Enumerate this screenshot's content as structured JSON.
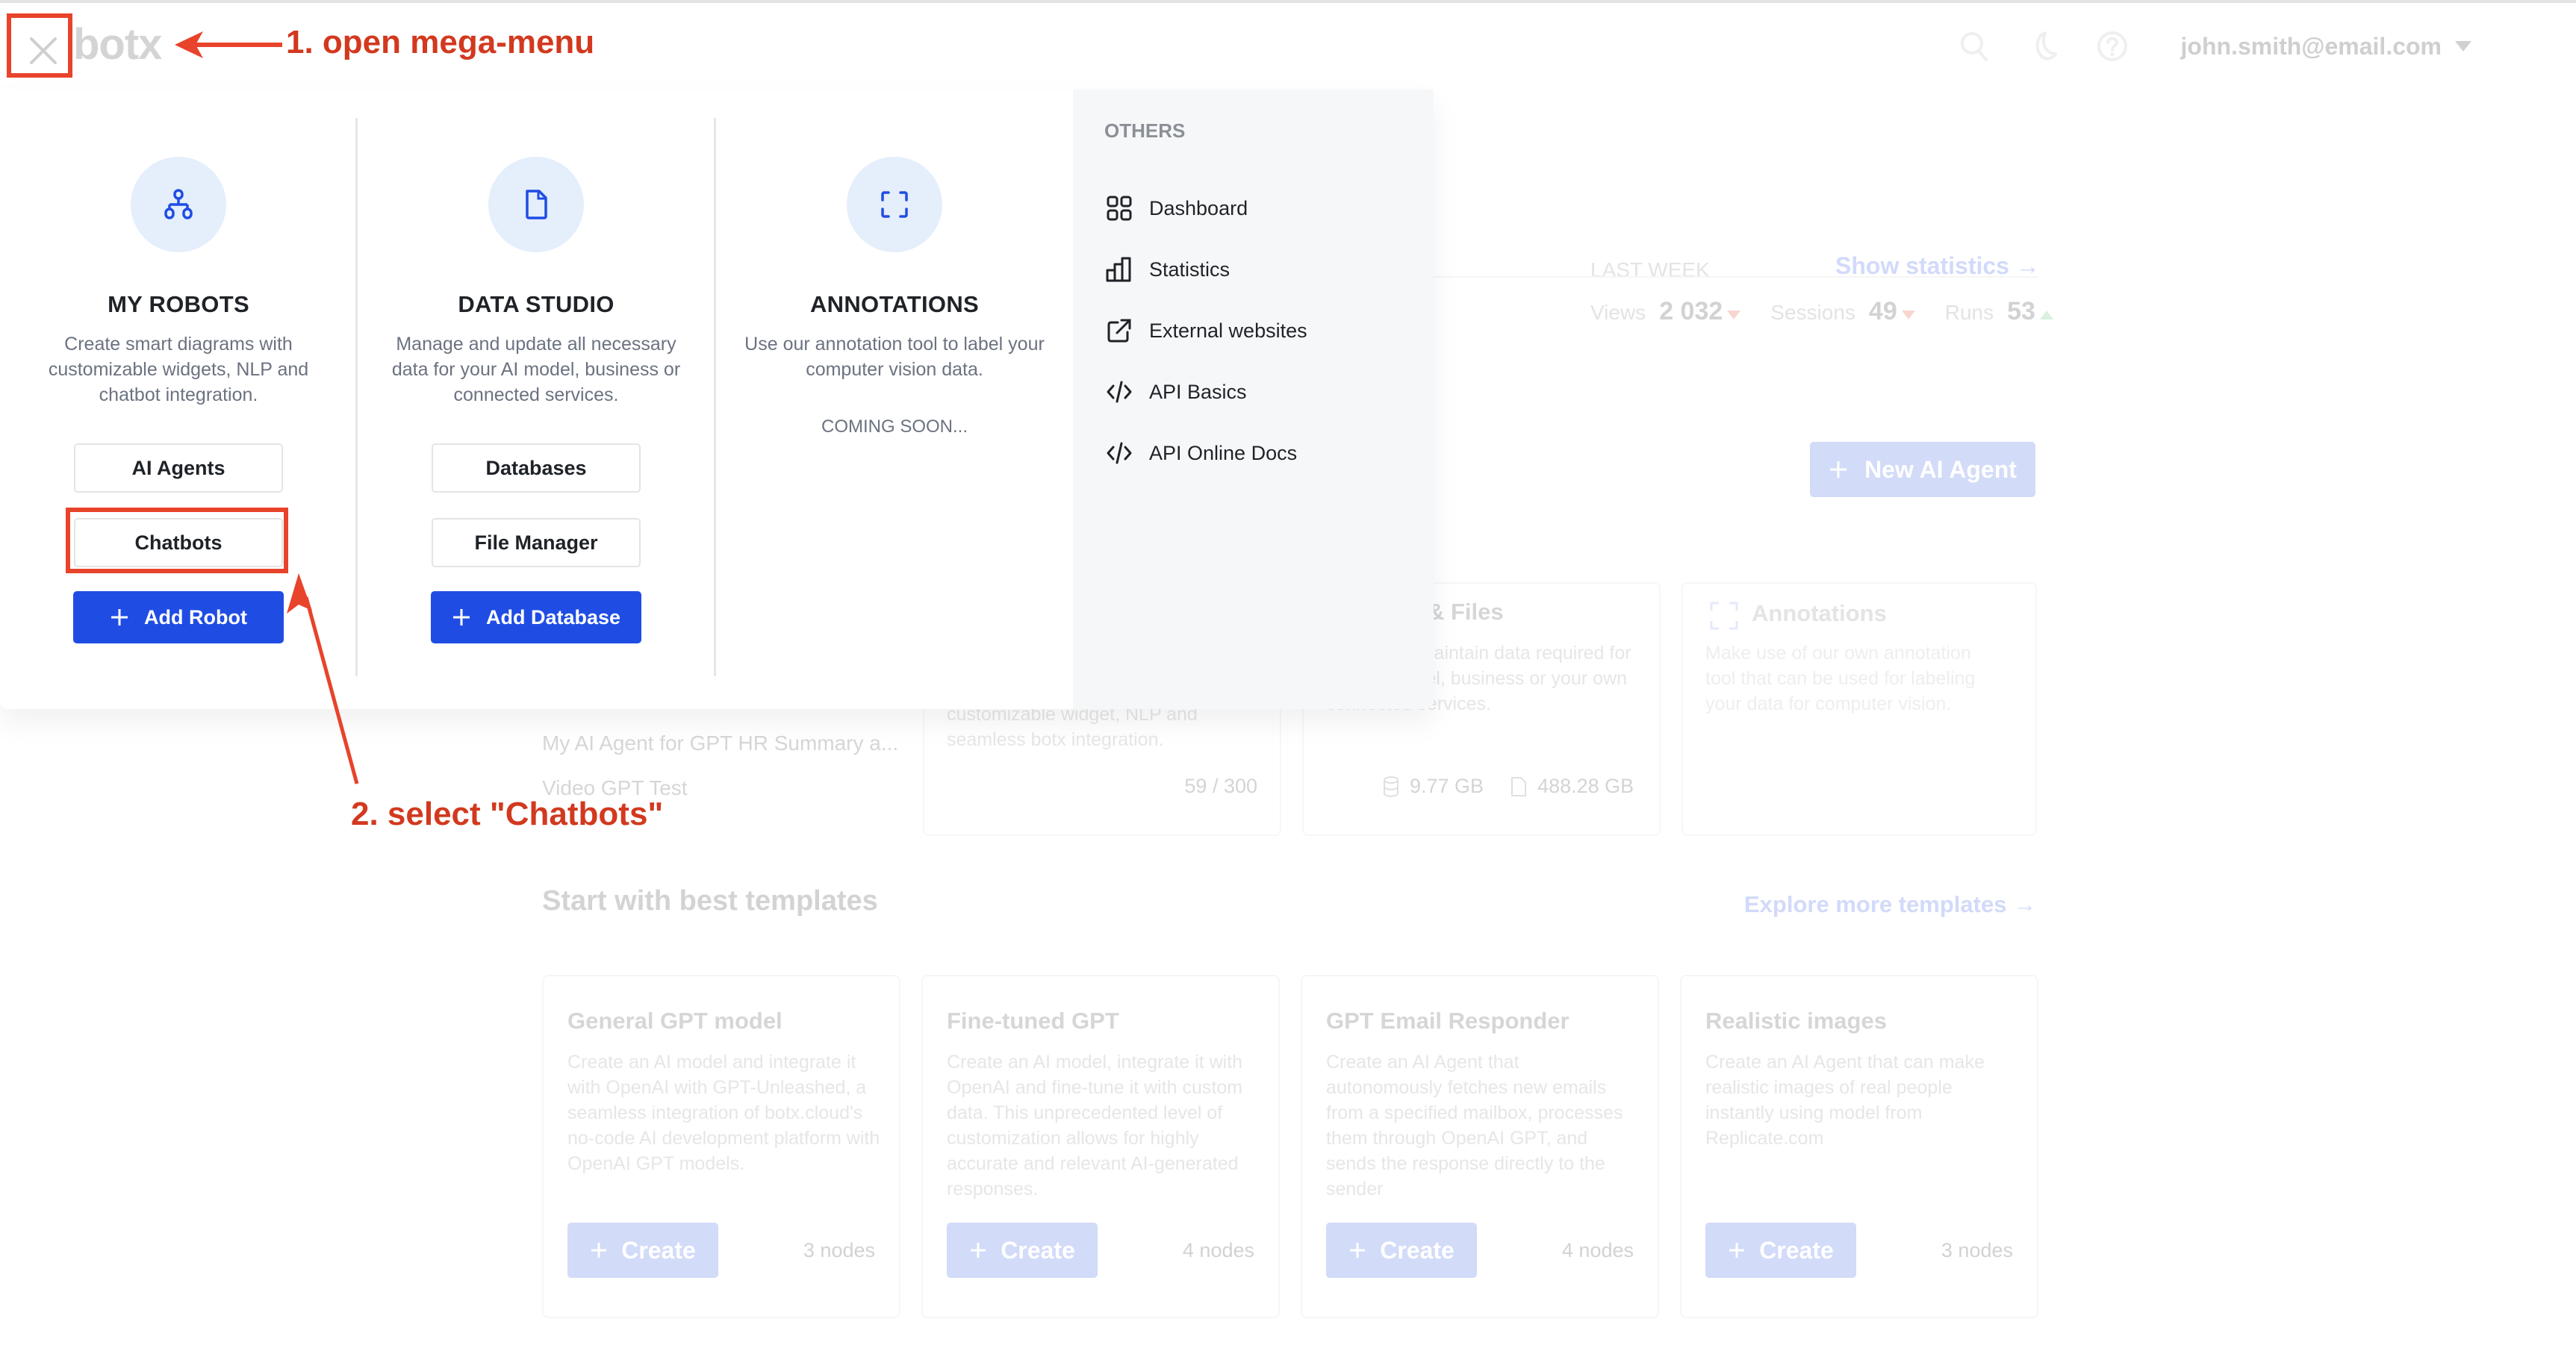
{
  "header": {
    "logo": "botx",
    "user_email": "john.smith@email.com",
    "icons": [
      "close-icon",
      "search-icon",
      "moon-icon",
      "help-icon",
      "chevron-down-icon"
    ]
  },
  "mega_menu": {
    "columns": [
      {
        "icon": "hierarchy-icon",
        "title": "MY ROBOTS",
        "description": "Create smart diagrams with customizable widgets, NLP and chatbot integration.",
        "buttons": [
          "AI Agents",
          "Chatbots"
        ],
        "primary_button": "Add Robot"
      },
      {
        "icon": "file-icon",
        "title": "DATA STUDIO",
        "description": "Manage and update all necessary data for your AI model, business or connected services.",
        "buttons": [
          "Databases",
          "File Manager"
        ],
        "primary_button": "Add Database"
      },
      {
        "icon": "scan-frame-icon",
        "title": "ANNOTATIONS",
        "description": "Use our annotation tool to label your computer vision data.",
        "status": "COMING SOON..."
      }
    ],
    "others": {
      "heading": "OTHERS",
      "items": [
        {
          "label": "Dashboard",
          "icon": "grid-icon"
        },
        {
          "label": "Statistics",
          "icon": "bar-chart-icon"
        },
        {
          "label": "External websites",
          "icon": "external-link-icon"
        },
        {
          "label": "API Basics",
          "icon": "code-icon"
        },
        {
          "label": "API Online Docs",
          "icon": "code-icon"
        }
      ]
    }
  },
  "background_page": {
    "stats": {
      "label": "LAST WEEK",
      "link": "Show statistics →",
      "items": [
        {
          "label": "Views",
          "value": "2 032",
          "trend": "down"
        },
        {
          "label": "Sessions",
          "value": "49",
          "trend": "down"
        },
        {
          "label": "Runs",
          "value": "53",
          "trend": "up"
        }
      ]
    },
    "new_agent_button": "New AI Agent",
    "recent_agents": [
      "My AI Agent for GPT HR Summary a...",
      "Video GPT Test"
    ],
    "cards": [
      {
        "description_partial": "customizable widget, NLP and seamless botx integration.",
        "usage": "59 / 300"
      },
      {
        "title_partial": "& Files",
        "description_partial": "pulate and maintain data required for your AI model, business or your own connected services.",
        "usage_db": "9.77 GB",
        "usage_files": "488.28 GB"
      },
      {
        "title": "Annotations",
        "description": "Make use of our own annotation tool that can be used for labeling your data for computer vision."
      }
    ],
    "templates": {
      "heading": "Start with best templates",
      "explore_link": "Explore more templates →",
      "items": [
        {
          "title": "General GPT model",
          "description": "Create an AI model and integrate it with OpenAI with GPT-Unleashed, a seamless integration of botx.cloud's no-code AI development platform with OpenAI GPT models.",
          "button": "Create",
          "nodes": "3 nodes"
        },
        {
          "title": "Fine-tuned GPT",
          "description": "Create an AI model, integrate it with OpenAI and fine-tune it with custom data. This unprecedented level of customization allows for highly accurate and relevant AI-generated responses.",
          "button": "Create",
          "nodes": "4 nodes"
        },
        {
          "title": "GPT Email Responder",
          "description": "Create an AI Agent that autonomously fetches new emails from a specified mailbox, processes them through OpenAI GPT, and sends the response directly to the sender",
          "button": "Create",
          "nodes": "4 nodes"
        },
        {
          "title": "Realistic images",
          "description": "Create an AI Agent that can make realistic images of real people instantly using model from Replicate.com",
          "button": "Create",
          "nodes": "3 nodes"
        }
      ]
    }
  },
  "annotations": {
    "step1": "1. open mega-menu",
    "step2": "2. select \"Chatbots\"",
    "color": "#e8432b"
  },
  "colors": {
    "primary": "#1f4de4",
    "primary_faded": "#d2dbf8",
    "icon_circle": "#e5eefb",
    "others_panel": "#f6f7f9"
  }
}
